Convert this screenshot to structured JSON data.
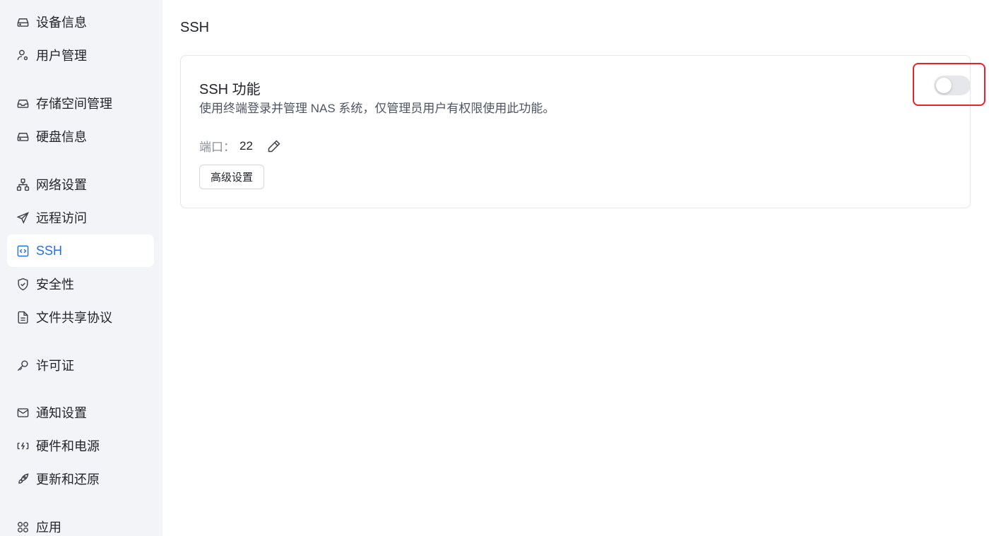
{
  "sidebar": {
    "items": [
      {
        "label": "设备信息",
        "icon": "hard-drive-icon"
      },
      {
        "label": "用户管理",
        "icon": "user-gear-icon"
      },
      {
        "label": "存储空间管理",
        "icon": "inbox-storage-icon"
      },
      {
        "label": "硬盘信息",
        "icon": "hard-drive-icon"
      },
      {
        "label": "网络设置",
        "icon": "network-icon"
      },
      {
        "label": "远程访问",
        "icon": "send-icon"
      },
      {
        "label": "SSH",
        "icon": "code-terminal-icon",
        "active": true
      },
      {
        "label": "安全性",
        "icon": "shield-check-icon"
      },
      {
        "label": "文件共享协议",
        "icon": "file-text-icon"
      },
      {
        "label": "许可证",
        "icon": "key-icon"
      },
      {
        "label": "通知设置",
        "icon": "mail-icon"
      },
      {
        "label": "硬件和电源",
        "icon": "power-plug-icon"
      },
      {
        "label": "更新和还原",
        "icon": "rocket-icon"
      },
      {
        "label": "应用",
        "icon": "apps-grid-icon"
      }
    ]
  },
  "main": {
    "title": "SSH",
    "card": {
      "title": "SSH 功能",
      "description": "使用终端登录并管理 NAS 系统，仅管理员用户有权限使用此功能。",
      "port_label": "端口：",
      "port_value": "22",
      "advanced_button": "高级设置",
      "toggle_enabled": false
    }
  },
  "colors": {
    "accent": "#2a6fdb",
    "highlight": "#e5232e",
    "sidebar_bg": "#f3f4f8"
  }
}
